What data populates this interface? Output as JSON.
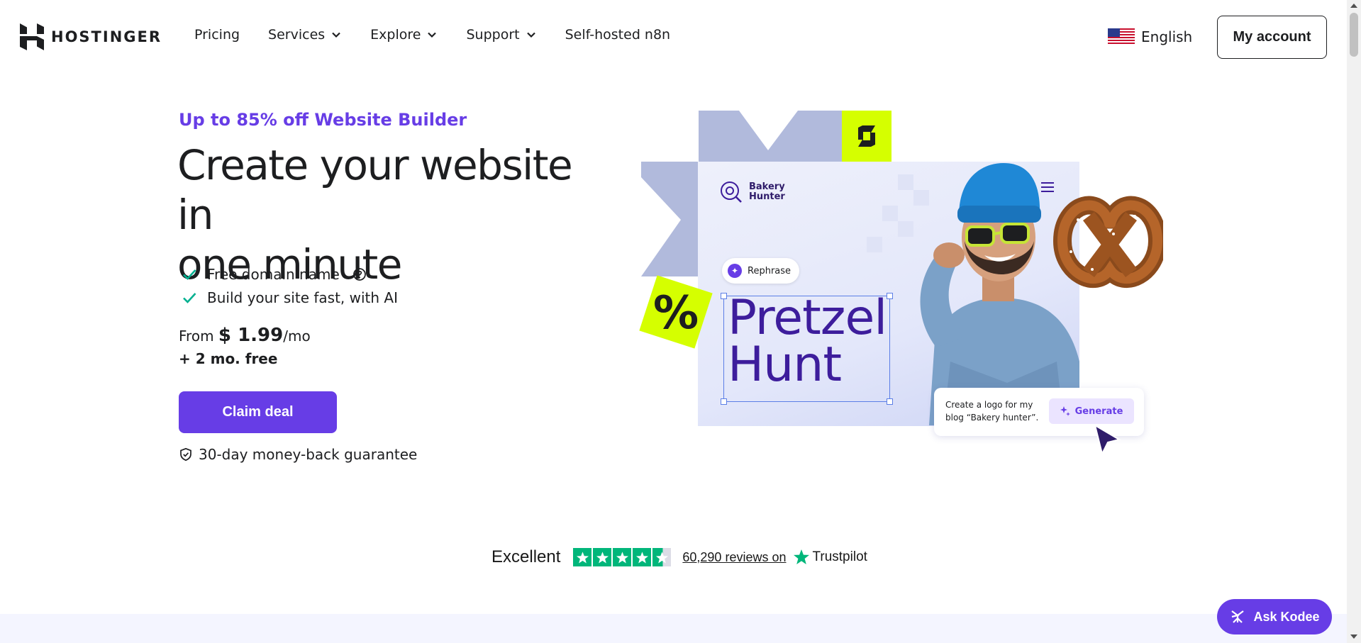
{
  "brand": {
    "name": "HOSTINGER",
    "accent": "#673de6",
    "text": "#1d1e20"
  },
  "nav": {
    "items": [
      {
        "label": "Pricing",
        "dropdown": false
      },
      {
        "label": "Services",
        "dropdown": true
      },
      {
        "label": "Explore",
        "dropdown": true
      },
      {
        "label": "Support",
        "dropdown": true
      },
      {
        "label": "Self-hosted n8n",
        "dropdown": false
      }
    ],
    "language": {
      "label": "English",
      "icon": "us-flag-icon"
    },
    "account_label": "My account"
  },
  "hero": {
    "eyebrow": "Up to 85% off Website Builder",
    "headline_line1": "Create your website in",
    "headline_line2": "one minute",
    "features": [
      {
        "label": "Free domain name",
        "info_icon": true
      },
      {
        "label": "Build your site fast, with AI",
        "info_icon": false
      }
    ],
    "price_prefix": "From",
    "price_amount": "$ 1.99",
    "price_suffix": "/mo",
    "bonus": "+ 2 mo. free",
    "cta_label": "Claim deal",
    "guarantee": "30-day money-back guarantee"
  },
  "illustration": {
    "site_name_line1": "Bakery",
    "site_name_line2": "Hunter",
    "rephrase_label": "Rephrase",
    "title_line1": "Pretzel",
    "title_line2": "Hunt",
    "prompt_text": "Create a logo for my blog “Bakery hunter”.",
    "generate_label": "Generate",
    "percent_symbol": "%"
  },
  "trustpilot": {
    "rating_label": "Excellent",
    "stars": 4.5,
    "reviews_text": "60,290 reviews on",
    "brand": "Trustpilot",
    "color": "#00b67a"
  },
  "assistant": {
    "label": "Ask Kodee"
  }
}
